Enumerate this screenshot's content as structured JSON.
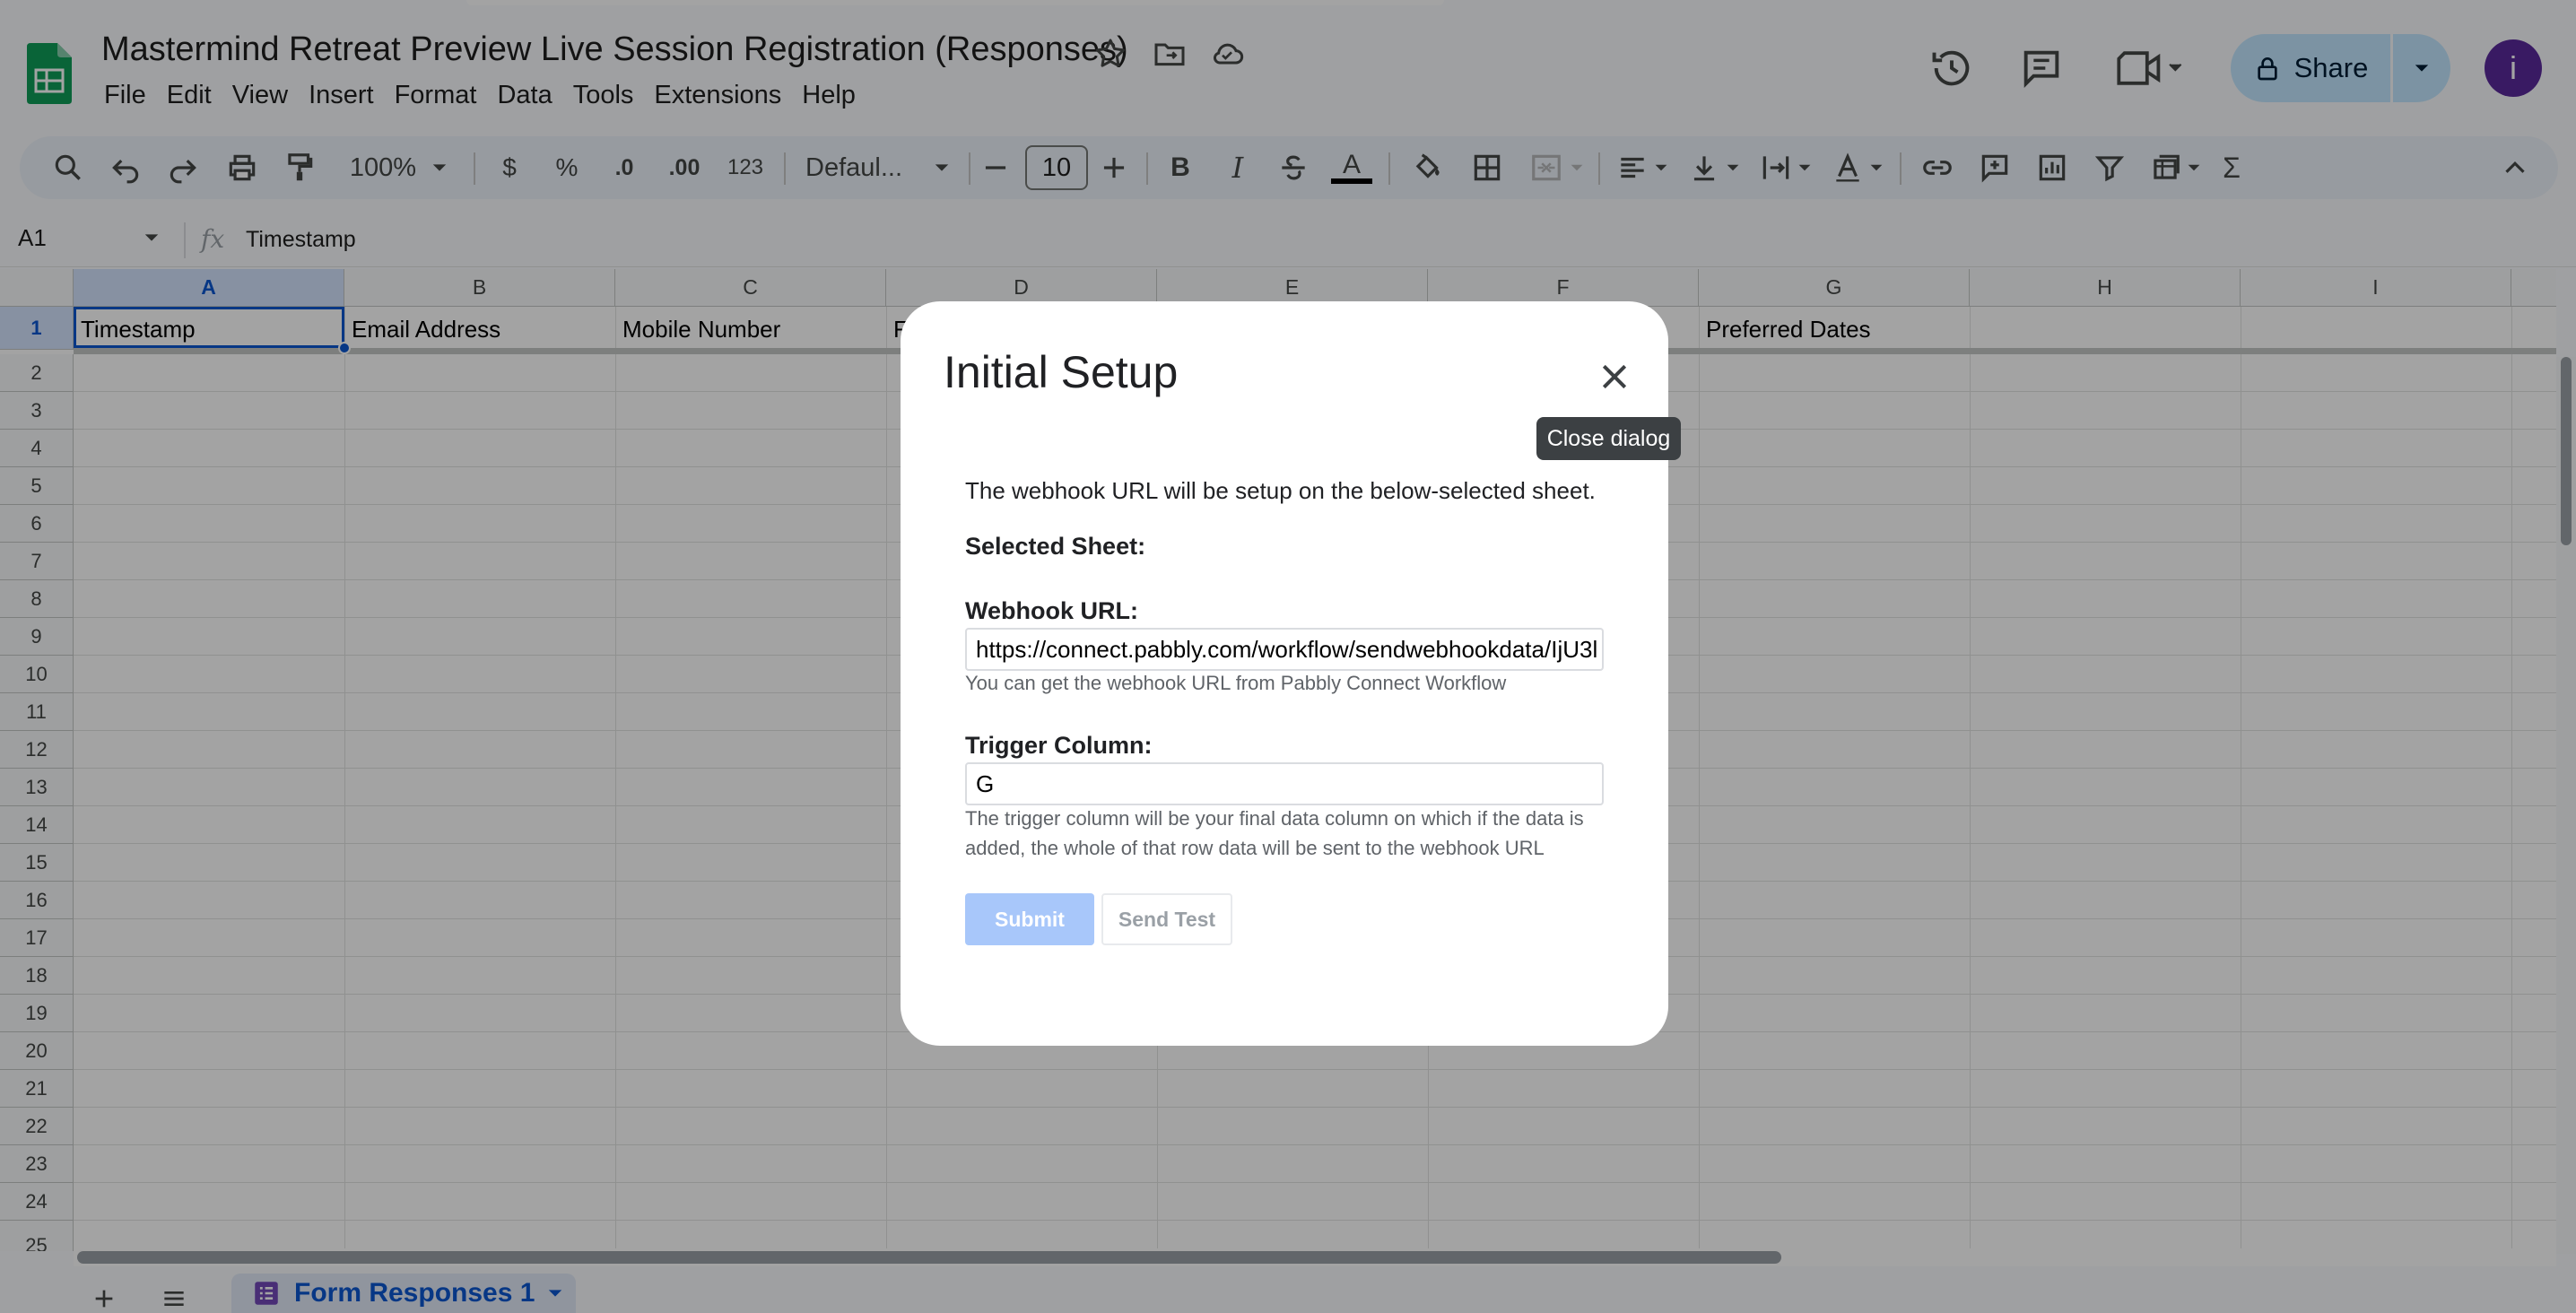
{
  "document": {
    "title": "Mastermind Retreat Preview Live Session Registration (Responses)"
  },
  "menu": [
    "File",
    "Edit",
    "View",
    "Insert",
    "Format",
    "Data",
    "Tools",
    "Extensions",
    "Help"
  ],
  "header": {
    "share_label": "Share",
    "avatar_initial": "i"
  },
  "toolbar": {
    "zoom": "100%",
    "currency": "$",
    "percent": "%",
    "decrease_decimal": ".0",
    "increase_decimal": ".00",
    "number_format": "123",
    "font": "Defaul...",
    "font_size": "10",
    "bold": "B",
    "italic": "I",
    "text_color_letter": "A",
    "sum_symbol": "Σ"
  },
  "formula_bar": {
    "cell_ref": "A1",
    "fx": "fx",
    "content": "Timestamp"
  },
  "grid": {
    "columns": [
      "A",
      "B",
      "C",
      "D",
      "E",
      "F",
      "G",
      "H",
      "I"
    ],
    "rows": [
      "1",
      "2",
      "3",
      "4",
      "5",
      "6",
      "7",
      "8",
      "9",
      "10",
      "11",
      "12",
      "13",
      "14",
      "15",
      "16",
      "17",
      "18",
      "19",
      "20",
      "21",
      "22",
      "23",
      "24",
      "25"
    ],
    "row1": {
      "A": "Timestamp",
      "B": "Email Address",
      "C": "Mobile Number",
      "D": "F",
      "G": "Preferred Dates"
    }
  },
  "sheet_tabs": {
    "active": "Form Responses 1"
  },
  "dialog": {
    "title": "Initial Setup",
    "close_tooltip": "Close dialog",
    "intro": "The webhook URL will be setup on the below-selected sheet.",
    "selected_sheet_label": "Selected Sheet:",
    "webhook_label": "Webhook URL:",
    "webhook_value": "https://connect.pabbly.com/workflow/sendwebhookdata/IjU3l",
    "webhook_help": "You can get the webhook URL from Pabbly Connect Workflow",
    "trigger_label": "Trigger Column:",
    "trigger_value": "G",
    "trigger_help": "The trigger column will be your final data column on which if the data is added, the whole of that row data will be sent to the webhook URL",
    "submit_label": "Submit",
    "send_test_label": "Send Test"
  },
  "colors": {
    "accent": "#0b57d0",
    "share_bg": "#c2e7ff",
    "avatar_bg": "#5a2a9b",
    "submit_bg": "#a8c7fa",
    "sheets_green": "#0f9d58"
  }
}
